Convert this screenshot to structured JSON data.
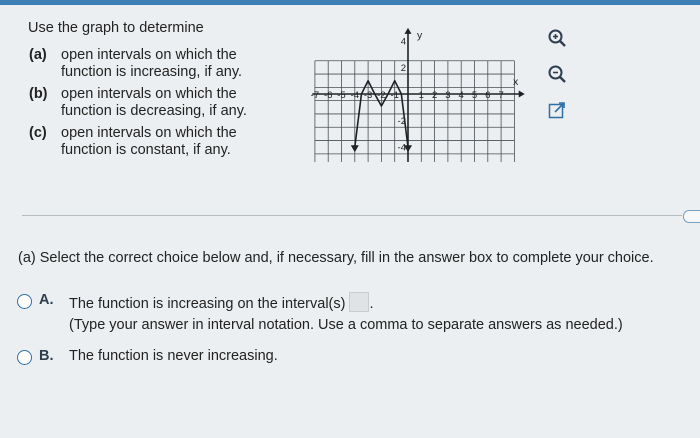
{
  "prompt": {
    "intro": "Use the graph to determine",
    "parts": [
      {
        "label": "(a)",
        "text": "open intervals on which the function is increasing, if any."
      },
      {
        "label": "(b)",
        "text": "open intervals on which the function is decreasing, if any."
      },
      {
        "label": "(c)",
        "text": "open intervals on which the function is constant, if any."
      }
    ]
  },
  "graph": {
    "y_axis_label": "y",
    "x_axis_label": "x",
    "x_ticks": [
      "-7",
      "-6",
      "-5",
      "-4",
      "-3",
      "-2",
      "-1",
      "1",
      "2",
      "3",
      "4",
      "5",
      "6",
      "7"
    ],
    "y_ticks": [
      "4",
      "2",
      "-2",
      "-4",
      "-6"
    ]
  },
  "tools": [
    "zoom-in-icon",
    "zoom-out-icon",
    "open-external-icon"
  ],
  "question": "(a) Select the correct choice below and, if necessary, fill in the answer box to complete your choice.",
  "choices": [
    {
      "letter": "A.",
      "text": "The function is increasing on the interval(s)",
      "note": "(Type your answer in interval notation. Use a comma to separate answers as needed.)"
    },
    {
      "letter": "B.",
      "text": "The function is never increasing."
    }
  ],
  "colors": {
    "accent": "#3e7fb6",
    "radio": "#2f6fa8",
    "background": "#eceff1"
  }
}
